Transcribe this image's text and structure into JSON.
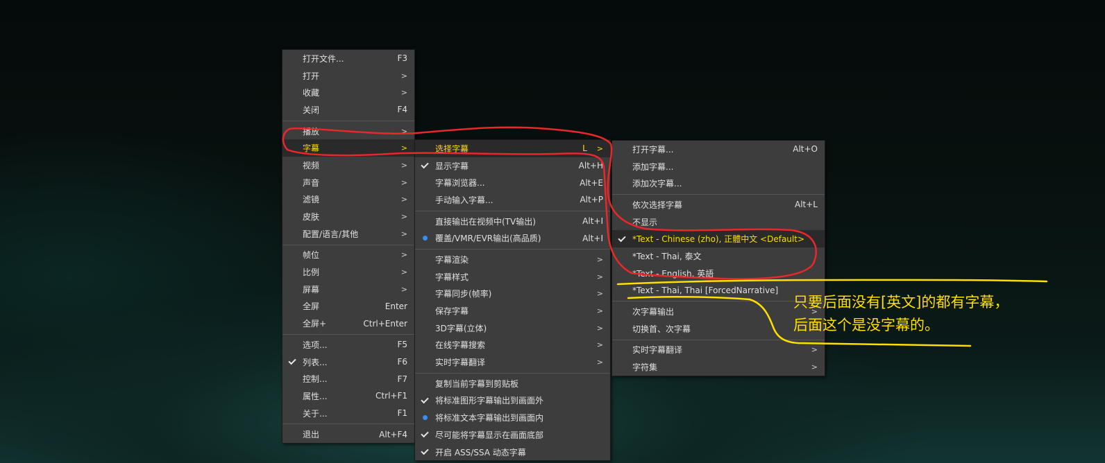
{
  "main_menu": [
    {
      "label": "打开文件...",
      "accel": "F3"
    },
    {
      "label": "打开",
      "arrow": ">"
    },
    {
      "label": "收藏",
      "arrow": ">"
    },
    {
      "label": "关闭",
      "accel": "F4"
    },
    {
      "sep": true
    },
    {
      "label": "播放",
      "arrow": ">"
    },
    {
      "label": "字幕",
      "arrow": ">",
      "active": true
    },
    {
      "label": "视频",
      "arrow": ">"
    },
    {
      "label": "声音",
      "arrow": ">"
    },
    {
      "label": "滤镜",
      "arrow": ">"
    },
    {
      "label": "皮肤",
      "arrow": ">"
    },
    {
      "label": "配置/语言/其他",
      "arrow": ">"
    },
    {
      "sep": true
    },
    {
      "label": "帧位",
      "arrow": ">"
    },
    {
      "label": "比例",
      "arrow": ">"
    },
    {
      "label": "屏幕",
      "arrow": ">"
    },
    {
      "label": "全屏",
      "accel": "Enter"
    },
    {
      "label": "全屏+",
      "accel": "Ctrl+Enter"
    },
    {
      "sep": true
    },
    {
      "label": "选项...",
      "accel": "F5"
    },
    {
      "label": "列表...",
      "accel": "F6",
      "mark": "check"
    },
    {
      "label": "控制...",
      "accel": "F7"
    },
    {
      "label": "属性...",
      "accel": "Ctrl+F1"
    },
    {
      "label": "关于...",
      "accel": "F1"
    },
    {
      "sep": true
    },
    {
      "label": "退出",
      "accel": "Alt+F4"
    }
  ],
  "subtitle_menu": [
    {
      "label": "选择字幕",
      "accel": "L",
      "arrow": ">",
      "active": true
    },
    {
      "label": "显示字幕",
      "accel": "Alt+H",
      "mark": "check"
    },
    {
      "label": "字幕浏览器...",
      "accel": "Alt+E"
    },
    {
      "label": "手动输入字幕...",
      "accel": "Alt+P"
    },
    {
      "sep": true
    },
    {
      "label": "直接输出在视频中(TV输出)",
      "accel": "Alt+I"
    },
    {
      "label": "覆盖/VMR/EVR输出(高品质)",
      "accel": "Alt+I",
      "mark": "radio"
    },
    {
      "sep": true
    },
    {
      "label": "字幕渲染",
      "arrow": ">"
    },
    {
      "label": "字幕样式",
      "arrow": ">"
    },
    {
      "label": "字幕同步(帧率)",
      "arrow": ">"
    },
    {
      "label": "保存字幕",
      "arrow": ">"
    },
    {
      "label": "3D字幕(立体)",
      "arrow": ">"
    },
    {
      "label": "在线字幕搜索",
      "arrow": ">"
    },
    {
      "label": "实时字幕翻译",
      "arrow": ">"
    },
    {
      "sep": true
    },
    {
      "label": "复制当前字幕到剪贴板"
    },
    {
      "label": "将标准图形字幕输出到画面外",
      "mark": "check"
    },
    {
      "label": "将标准文本字幕输出到画面内",
      "mark": "radio"
    },
    {
      "label": "尽可能将字幕显示在画面底部",
      "mark": "check"
    },
    {
      "label": "开启 ASS/SSA 动态字幕",
      "mark": "check"
    }
  ],
  "select_menu": [
    {
      "label": "打开字幕...",
      "accel": "Alt+O"
    },
    {
      "label": "添加字幕..."
    },
    {
      "label": "添加次字幕..."
    },
    {
      "sep": true
    },
    {
      "label": "依次选择字幕",
      "accel": "Alt+L"
    },
    {
      "label": "不显示"
    },
    {
      "label": "*Text - Chinese (zho), 正體中文  <Default>",
      "mark": "check",
      "active": true
    },
    {
      "label": "*Text - Thai, 泰文"
    },
    {
      "label": "*Text - English, 英語"
    },
    {
      "label": "*Text - Thai, Thai [ForcedNarrative]"
    },
    {
      "sep": true
    },
    {
      "label": "次字幕输出",
      "arrow": ">"
    },
    {
      "label": "切换首、次字幕"
    },
    {
      "sep": true
    },
    {
      "label": "实时字幕翻译",
      "arrow": ">"
    },
    {
      "label": "字符集",
      "arrow": ">"
    }
  ],
  "annotation": {
    "line1": "只要后面没有[英文]的都有字幕，",
    "line2": "后面这个是没字幕的。"
  },
  "colors": {
    "menu_bg": "#3d3d3d",
    "highlight_text": "#ffde00",
    "annotation_red": "#e8282a",
    "annotation_yellow": "#ffde00"
  }
}
